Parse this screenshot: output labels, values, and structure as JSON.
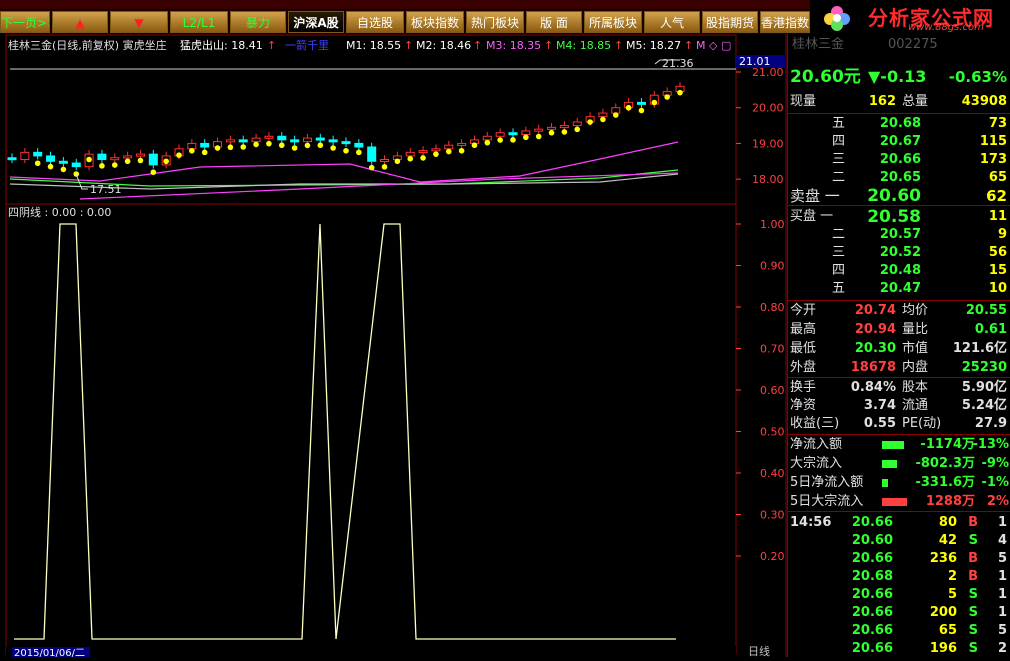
{
  "toolbar": {
    "buttons": [
      {
        "label": "下一页>>",
        "style": "green"
      },
      {
        "label": "▲",
        "style": "red"
      },
      {
        "label": "▼",
        "style": "red"
      },
      {
        "label": "L2/L1",
        "style": "green"
      },
      {
        "label": "暴力",
        "style": "green"
      },
      {
        "label": "沪深A股",
        "style": "active"
      },
      {
        "label": "自选股",
        "style": ""
      },
      {
        "label": "板块指数",
        "style": ""
      },
      {
        "label": "热门板块",
        "style": ""
      },
      {
        "label": "版 面",
        "style": ""
      },
      {
        "label": "所属板块",
        "style": ""
      },
      {
        "label": "人气",
        "style": ""
      },
      {
        "label": "股指期货",
        "style": ""
      },
      {
        "label": "香港指数",
        "style": ""
      }
    ],
    "logo_name": "分析家公式网",
    "logo_url": "www.88gs.com"
  },
  "chart": {
    "header": {
      "title": "桂林三金(日线,前复权) 寅虎坐庄",
      "indicator": "猛虎出山: 18.41",
      "line_label": "一箭千里",
      "m1": "M1: 18.55",
      "m2": "M2: 18.46",
      "m3": "M3: 18.35",
      "m4": "M4: 18.85",
      "m5": "M5: 18.27",
      "m_suffix": "M ◇ ▢"
    },
    "price_axis": [
      "21.00",
      "20.00",
      "19.00",
      "18.00"
    ],
    "top_label": "21.01",
    "max_marker": "21.36",
    "min_marker": "17.51",
    "sub_title": "四阴线 : 0.00 : 0.00",
    "sub_axis": [
      "1.00",
      "0.90",
      "0.80",
      "0.70",
      "0.60",
      "0.50",
      "0.40",
      "0.30",
      "0.20"
    ],
    "date_label": "2015/01/06/二",
    "period_label": "日线",
    "colors": {
      "up": "#ff3030",
      "down": "#00ffff",
      "ma_yellow": "#ffff00",
      "ma_magenta": "#ff40ff",
      "ma_green": "#40ff40",
      "signal": "#ffffc0",
      "grid": "#8a0000"
    }
  },
  "quote": {
    "stock_name": "桂林三金",
    "code": "002275",
    "price": "20.60元",
    "change": "▼-0.13",
    "change_pct": "-0.63%",
    "vol_label": "现量",
    "vol": "162",
    "total_label": "总量",
    "total": "43908",
    "asks": [
      {
        "label": "五",
        "price": "20.68",
        "qty": "73"
      },
      {
        "label": "四",
        "price": "20.67",
        "qty": "115"
      },
      {
        "label": "三",
        "price": "20.66",
        "qty": "173"
      },
      {
        "label": "二",
        "price": "20.65",
        "qty": "65"
      },
      {
        "label": "卖盘 一",
        "price": "20.60",
        "qty": "62"
      }
    ],
    "bids": [
      {
        "label": "买盘 一",
        "price": "20.58",
        "qty": "11"
      },
      {
        "label": "二",
        "price": "20.57",
        "qty": "9"
      },
      {
        "label": "三",
        "price": "20.52",
        "qty": "56"
      },
      {
        "label": "四",
        "price": "20.48",
        "qty": "15"
      },
      {
        "label": "五",
        "price": "20.47",
        "qty": "10"
      }
    ],
    "stats": [
      {
        "l1": "今开",
        "v1": "20.74",
        "c1": "r",
        "l2": "均价",
        "v2": "20.55",
        "c2": "g"
      },
      {
        "l1": "最高",
        "v1": "20.94",
        "c1": "r",
        "l2": "量比",
        "v2": "0.61",
        "c2": "g"
      },
      {
        "l1": "最低",
        "v1": "20.30",
        "c1": "g",
        "l2": "市值",
        "v2": "121.6亿",
        "c2": "w"
      },
      {
        "l1": "外盘",
        "v1": "18678",
        "c1": "r",
        "l2": "内盘",
        "v2": "25230",
        "c2": "g"
      }
    ],
    "stats2": [
      {
        "l1": "换手",
        "v1": "0.84%",
        "l2": "股本",
        "v2": "5.90亿"
      },
      {
        "l1": "净资",
        "v1": "3.74",
        "l2": "流通",
        "v2": "5.24亿"
      },
      {
        "l1": "收益(三)",
        "v1": "0.55",
        "l2": "PE(动)",
        "v2": "27.9"
      }
    ],
    "flows": [
      {
        "label": "净流入额",
        "value": "-1174万",
        "pct": "-13%",
        "bar": 0.8,
        "color": "g"
      },
      {
        "label": "大宗流入",
        "value": "-802.3万",
        "pct": "-9%",
        "bar": 0.55,
        "color": "g"
      },
      {
        "label": "5日净流入额",
        "value": "-331.6万",
        "pct": "-1%",
        "bar": 0.2,
        "color": "g"
      },
      {
        "label": "5日大宗流入",
        "value": "1288万",
        "pct": "2%",
        "bar": 0.9,
        "color": "r"
      }
    ],
    "ticks": [
      {
        "time": "14:56",
        "price": "20.66",
        "qty": "80",
        "side": "B",
        "n": "1"
      },
      {
        "time": "",
        "price": "20.60",
        "qty": "42",
        "side": "S",
        "n": "4"
      },
      {
        "time": "",
        "price": "20.66",
        "qty": "236",
        "side": "B",
        "n": "5"
      },
      {
        "time": "",
        "price": "20.68",
        "qty": "2",
        "side": "B",
        "n": "1"
      },
      {
        "time": "",
        "price": "20.66",
        "qty": "5",
        "side": "S",
        "n": "1"
      },
      {
        "time": "",
        "price": "20.66",
        "qty": "200",
        "side": "S",
        "n": "1"
      },
      {
        "time": "",
        "price": "20.66",
        "qty": "65",
        "side": "S",
        "n": "5"
      },
      {
        "time": "",
        "price": "20.66",
        "qty": "196",
        "side": "S",
        "n": "2"
      }
    ]
  }
}
